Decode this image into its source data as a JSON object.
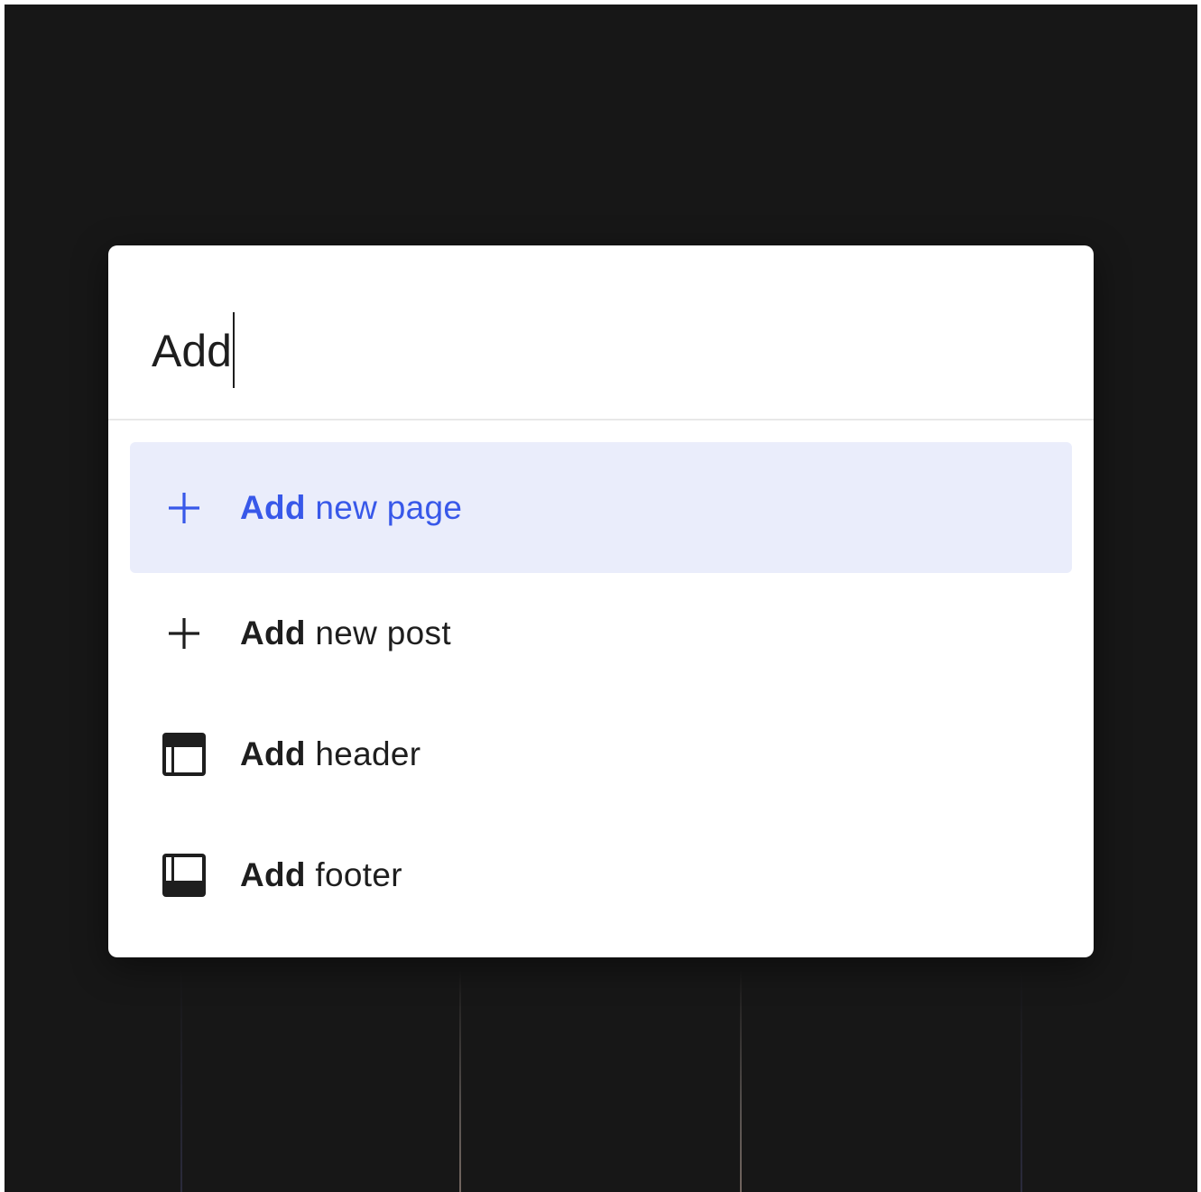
{
  "search": {
    "value": "Add"
  },
  "results": [
    {
      "match": "Add",
      "rest": " new page",
      "icon": "plus-icon",
      "selected": true
    },
    {
      "match": "Add",
      "rest": " new post",
      "icon": "plus-icon",
      "selected": false
    },
    {
      "match": "Add",
      "rest": " header",
      "icon": "header-layout-icon",
      "selected": false
    },
    {
      "match": "Add",
      "rest": " footer",
      "icon": "footer-layout-icon",
      "selected": false
    }
  ],
  "colors": {
    "backdrop": "#171717",
    "selected_background": "#eaedfb",
    "selected_text": "#3858e9",
    "text": "#1e1e1e"
  }
}
